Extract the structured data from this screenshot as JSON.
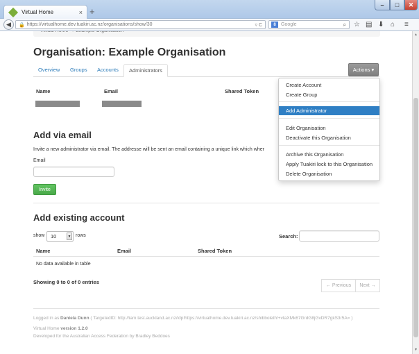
{
  "browser": {
    "tab_title": "Virtual Home",
    "tab_close": "×",
    "new_tab": "+",
    "url": "https://virtualhome.dev.tuakiri.ac.nz/organisations/show/30",
    "search_placeholder": "Google",
    "search_engine": "8",
    "window_controls": {
      "minimize": "–",
      "maximize": "□",
      "close": "✕"
    }
  },
  "breadcrumb": "Virtual Home   →   Example Organisation",
  "page_title": "Organisation: Example Organisation",
  "tabs": [
    {
      "label": "Overview"
    },
    {
      "label": "Groups"
    },
    {
      "label": "Accounts"
    },
    {
      "label": "Administrators",
      "active": true
    }
  ],
  "actions": {
    "label": "Actions ▾",
    "menu": [
      {
        "label": "Create Account"
      },
      {
        "label": "Create Group"
      },
      {
        "label": "Add Administrator",
        "active": true
      },
      {
        "label": "Edit Organisation"
      },
      {
        "label": "Deactivate this Organisation"
      },
      {
        "label": "Archive this Organisation"
      },
      {
        "label": "Apply Tuakiri lock to this Organisation"
      },
      {
        "label": "Delete Organisation"
      }
    ]
  },
  "admin_table": {
    "headers": {
      "name": "Name",
      "email": "Email",
      "token": "Shared Token"
    }
  },
  "add_via_email": {
    "title": "Add via email",
    "description": "Invite a new administrator via email. The addresse will be sent an email containing a unique link which wher",
    "email_label": "Email",
    "email_value": "",
    "invite_label": "Invite"
  },
  "add_existing": {
    "title": "Add existing account",
    "show_label": "show",
    "rows_value": "10",
    "rows_label": "rows",
    "search_label": "Search:",
    "search_value": "",
    "headers": {
      "name": "Name",
      "email": "Email",
      "token": "Shared Token"
    },
    "empty_text": "No data available in table",
    "info": "Showing 0 to 0 of 0 entries",
    "prev_label": "← Previous",
    "next_label": "Next →"
  },
  "footer": {
    "logged_in_prefix": "Logged in as",
    "user_name": "Daniela Dunn",
    "targeted_id": "( TargetedID: http://iam.test.auckland.ac.nz/idp!https://virtualhome.dev.tuakiri.ac.nz/shibboleth!+vtaXMk67GrdG8jGvDR7gkS3r5A= )",
    "app_name": "Virtual Home",
    "version": "version 1.2.0",
    "developed_by": "Developed for the Australian Access Federation by Bradley Beddoes"
  }
}
